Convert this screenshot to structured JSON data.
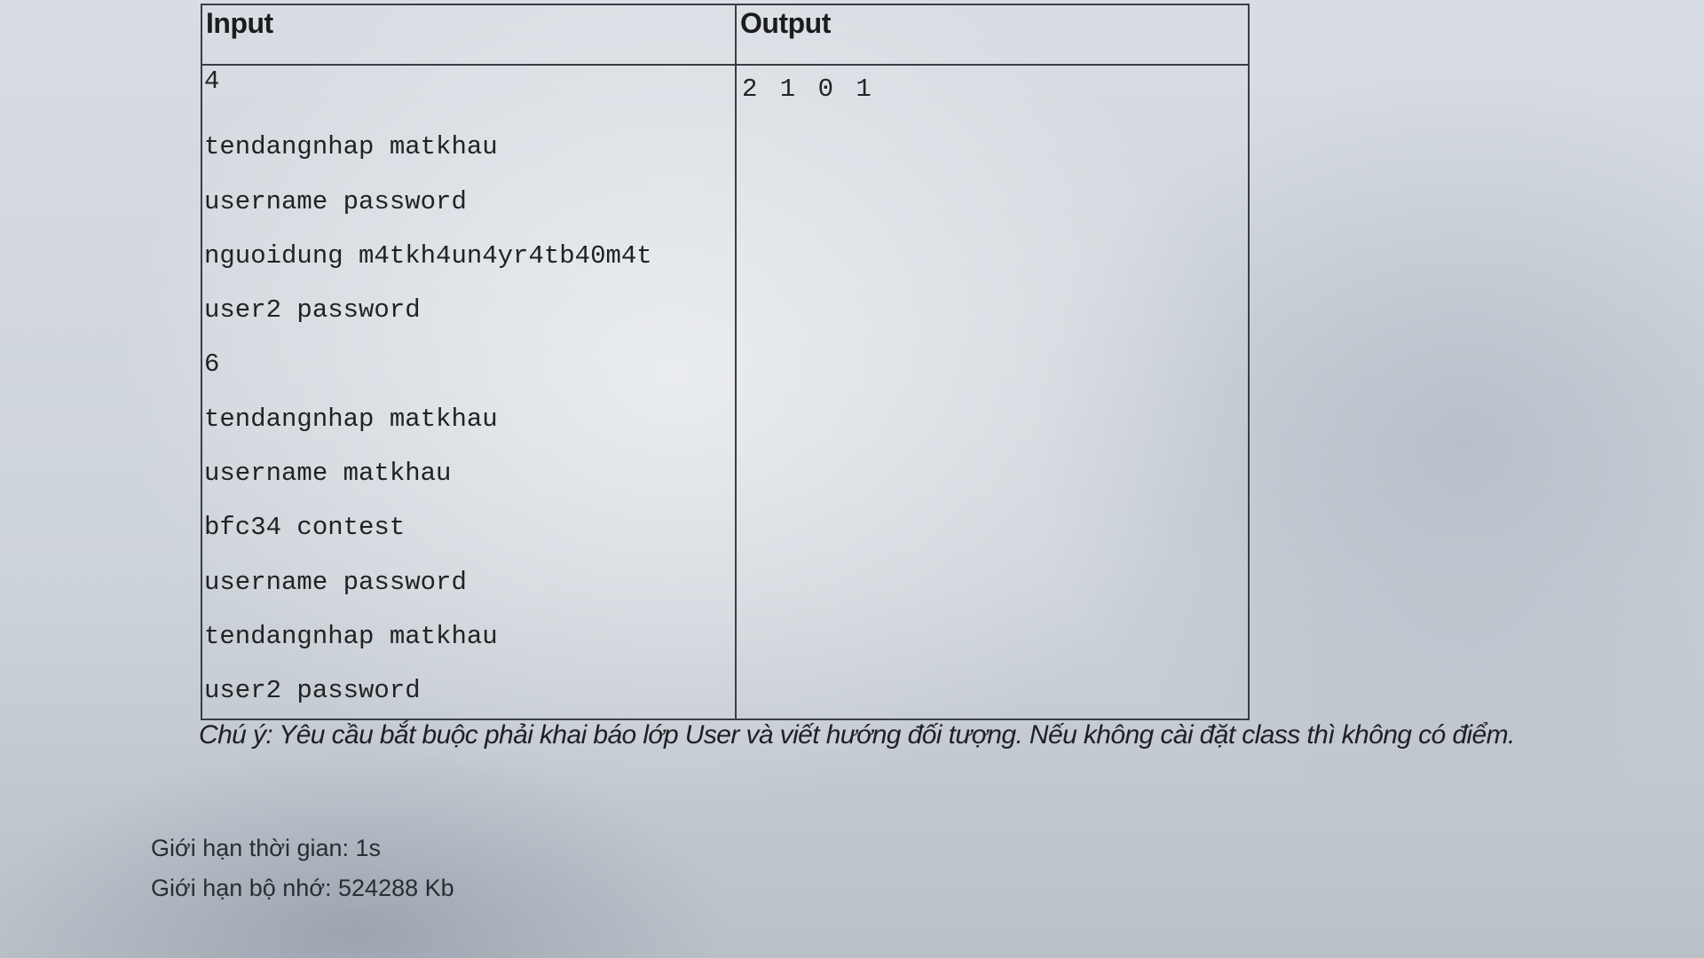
{
  "table": {
    "headers": {
      "input": "Input",
      "output": "Output"
    },
    "input_lines": [
      "4",
      "tendangnhap matkhau",
      "username password",
      "nguoidung m4tkh4un4yr4tb40m4t",
      "user2 password",
      "6",
      "tendangnhap matkhau",
      "username matkhau",
      "bfc34 contest",
      "username password",
      "tendangnhap matkhau",
      "user2 password"
    ],
    "output_lines": [
      "2 1 0 1"
    ]
  },
  "note": "Chú ý: Yêu cầu bắt buộc phải khai báo lớp User và viết hướng đối tượng. Nếu không cài đặt class thì không có điểm.",
  "limits": {
    "time": "Giới hạn thời gian: 1s",
    "memory": "Giới hạn bộ nhớ: 524288 Kb"
  }
}
